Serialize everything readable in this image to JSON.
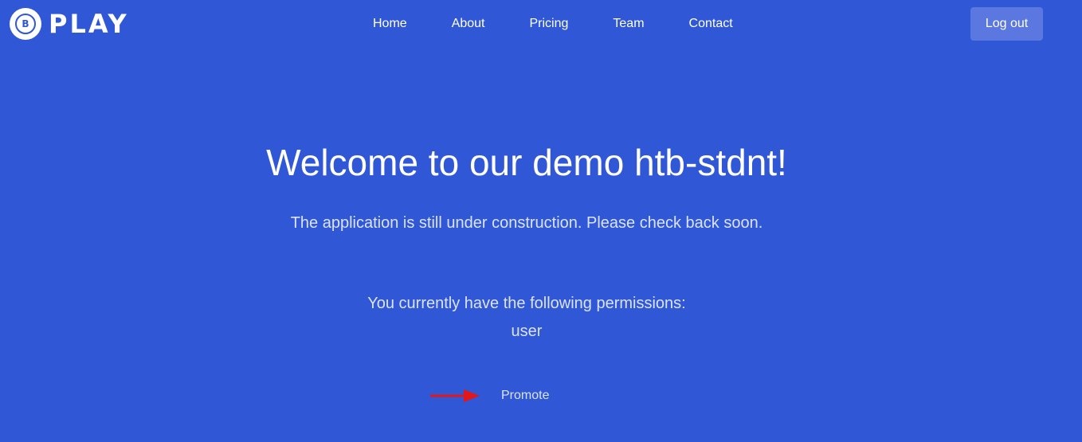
{
  "header": {
    "logo_letter": "B",
    "logo_text": "PLAY",
    "nav": [
      "Home",
      "About",
      "Pricing",
      "Team",
      "Contact"
    ],
    "logout_label": "Log out"
  },
  "main": {
    "headline": "Welcome to our demo htb-stdnt!",
    "lead": "The application is still under construction. Please check back soon.",
    "permissions_label": "You currently have the following permissions:",
    "permissions_value": "user",
    "promote_label": "Promote"
  },
  "annotation": {
    "arrow_color": "#e3161a"
  },
  "colors": {
    "background": "#3057d5",
    "button": "#5a78df",
    "muted_text": "#dbe3fa"
  }
}
